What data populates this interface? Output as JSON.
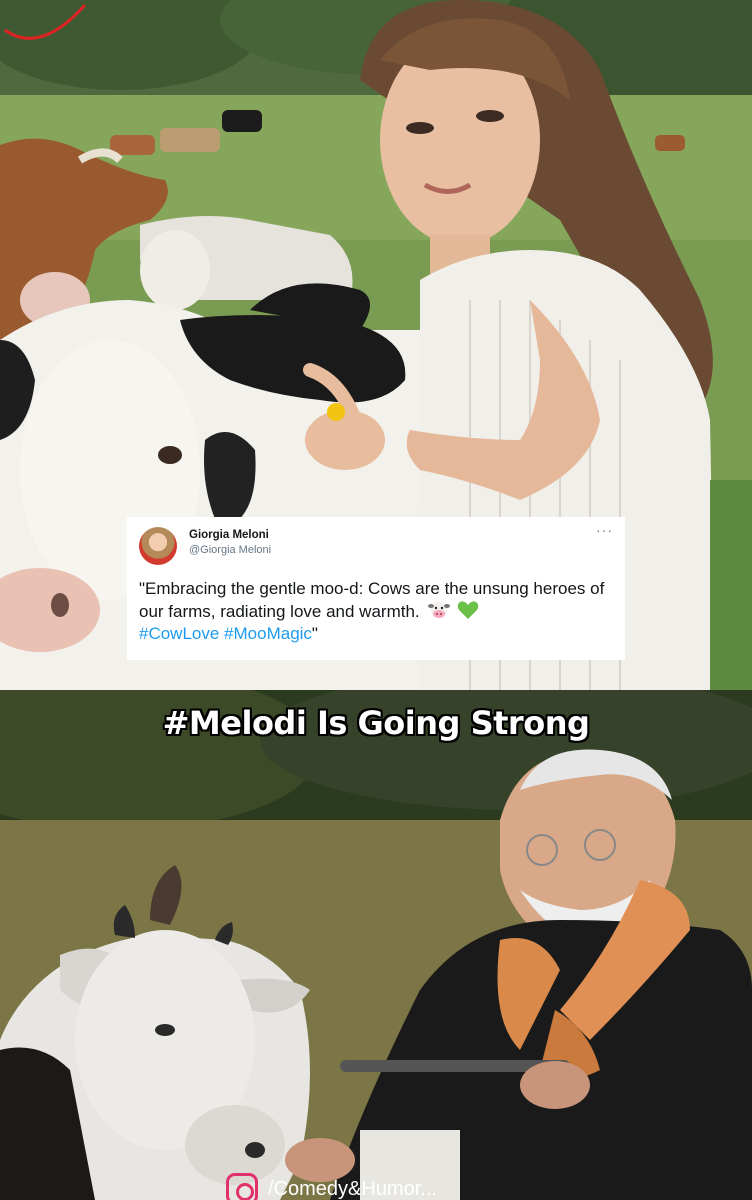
{
  "tweet": {
    "name": "Giorgia Meloni",
    "handle": "@Giorgia Meloni",
    "more_glyph": "···",
    "text": "\"Embracing the gentle moo-d: Cows are the unsung heroes of our farms, radiating love and warmth.",
    "hashtags": "#CowLove #MooMagic",
    "closing_quote": "\""
  },
  "caption": "#Melodi Is Going Strong",
  "watermark": {
    "text": "/Comedy&Humor..."
  },
  "colors": {
    "hashtag": "#1d9bf0",
    "caption_text": "#ffffff",
    "instagram": "#e1306c"
  },
  "icons": {
    "cow_emoji": "cow-face-icon",
    "heart_emoji": "green-heart-icon",
    "more": "more-dots-icon",
    "instagram": "instagram-icon"
  }
}
